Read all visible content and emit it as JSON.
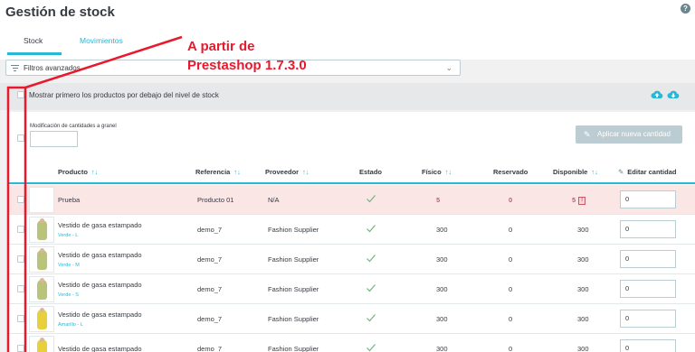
{
  "page": {
    "title": "Gestión de stock",
    "help_icon": "?"
  },
  "tabs": [
    {
      "label": "Stock",
      "active": true
    },
    {
      "label": "Movimientos",
      "active": false
    }
  ],
  "filters": {
    "label": "Filtros avanzados",
    "icon": "filter-lines-icon"
  },
  "info": {
    "checkbox_label": "Mostrar primero los productos por debajo del nivel de stock",
    "icons": [
      "cloud-upload-icon",
      "cloud-download-icon"
    ]
  },
  "bulk": {
    "label": "Modificación de cantidades a granel",
    "value": "",
    "apply_label": "Aplicar nueva cantidad"
  },
  "table": {
    "headers": {
      "producto": "Producto",
      "referencia": "Referencia",
      "proveedor": "Proveedor",
      "estado": "Estado",
      "fisico": "Físico",
      "reservado": "Reservado",
      "disponible": "Disponible",
      "editar": "Editar cantidad"
    },
    "sort_icon": "↑↓",
    "rows": [
      {
        "name": "Prueba",
        "attribute": "",
        "reference": "Producto 01",
        "supplier": "N/A",
        "status": "active",
        "physical": "5",
        "reserved": "0",
        "available": "5",
        "warning": "!",
        "qty": "0",
        "low_stock": true,
        "thumb_color": ""
      },
      {
        "name": "Vestido de gasa estampado",
        "attribute": "Verde - L",
        "reference": "demo_7",
        "supplier": "Fashion Supplier",
        "status": "active",
        "physical": "300",
        "reserved": "0",
        "available": "300",
        "warning": "",
        "qty": "0",
        "low_stock": false,
        "thumb_color": "#b9c47a"
      },
      {
        "name": "Vestido de gasa estampado",
        "attribute": "Verde - M",
        "reference": "demo_7",
        "supplier": "Fashion Supplier",
        "status": "active",
        "physical": "300",
        "reserved": "0",
        "available": "300",
        "warning": "",
        "qty": "0",
        "low_stock": false,
        "thumb_color": "#b9c47a"
      },
      {
        "name": "Vestido de gasa estampado",
        "attribute": "Verde - S",
        "reference": "demo_7",
        "supplier": "Fashion Supplier",
        "status": "active",
        "physical": "300",
        "reserved": "0",
        "available": "300",
        "warning": "",
        "qty": "0",
        "low_stock": false,
        "thumb_color": "#b9c47a"
      },
      {
        "name": "Vestido de gasa estampado",
        "attribute": "Amarillo - L",
        "reference": "demo_7",
        "supplier": "Fashion Supplier",
        "status": "active",
        "physical": "300",
        "reserved": "0",
        "available": "300",
        "warning": "",
        "qty": "0",
        "low_stock": false,
        "thumb_color": "#e8cf3c"
      },
      {
        "name": "Vestido de gasa estampado",
        "attribute": "",
        "reference": "demo_7",
        "supplier": "Fashion Supplier",
        "status": "active",
        "physical": "300",
        "reserved": "0",
        "available": "300",
        "warning": "",
        "qty": "0",
        "low_stock": false,
        "thumb_color": "#e8cf3c"
      }
    ]
  },
  "annotation": {
    "line1": "A partir de",
    "line2": "Prestashop 1.7.3.0",
    "color": "#e8192c"
  }
}
